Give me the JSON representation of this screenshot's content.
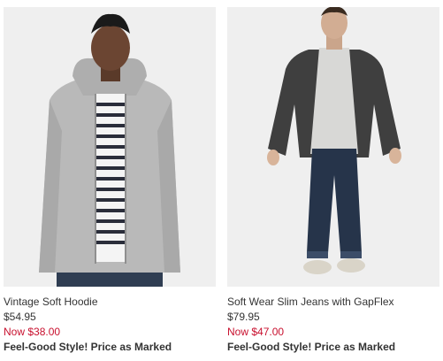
{
  "products": [
    {
      "name": "Vintage Soft Hoodie",
      "original_price": "$54.95",
      "sale_price": "Now $38.00",
      "promo": "Feel-Good Style! Price as Marked"
    },
    {
      "name": "Soft Wear Slim Jeans with GapFlex",
      "original_price": "$79.95",
      "sale_price": "Now $47.00",
      "promo": "Feel-Good Style! Price as Marked"
    }
  ],
  "colors": {
    "sale": "#c8102e",
    "text": "#333333",
    "image_bg": "#efefef"
  }
}
